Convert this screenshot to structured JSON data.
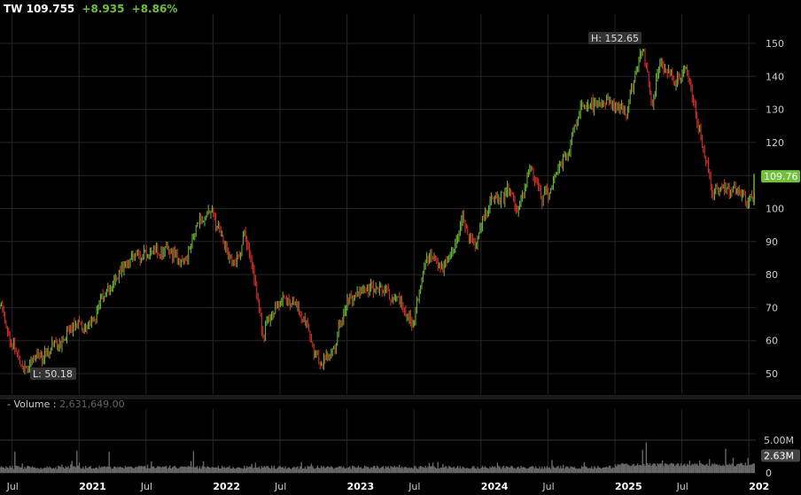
{
  "header": {
    "symbol": "TW",
    "price": "109.755",
    "change": "+8.935",
    "change_pct": "+8.86%"
  },
  "volume_panel": {
    "label": "- Volume :",
    "value": "2,631,649.00"
  },
  "colors": {
    "up": "#6fc13a",
    "down": "#e8322a",
    "grid": "#262626",
    "volume": "#6a6a6a",
    "last_price_bg": "#6fc13a"
  },
  "chart_data": {
    "type": "candlestick",
    "symbol": "TW",
    "x_axis": {
      "labels": [
        "Jul",
        "2021",
        "Jul",
        "2022",
        "Jul",
        "2023",
        "Jul",
        "2024",
        "Jul",
        "2025",
        "Jul",
        "202"
      ],
      "label_months_since_2020_06": [
        1,
        7,
        13,
        19,
        25,
        31,
        37,
        43,
        49,
        55,
        61,
        67
      ]
    },
    "y_axis": {
      "ticks": [
        50,
        60,
        70,
        80,
        90,
        100,
        110,
        120,
        130,
        140,
        150
      ],
      "range": [
        46,
        157
      ]
    },
    "price_path_months_since_2020_06": [
      [
        0,
        70
      ],
      [
        1.2,
        58
      ],
      [
        2.4,
        52
      ],
      [
        4,
        57
      ],
      [
        6.3,
        65
      ],
      [
        7.9,
        65
      ],
      [
        10.3,
        80
      ],
      [
        12.7,
        86
      ],
      [
        15.1,
        88
      ],
      [
        16.3,
        82
      ],
      [
        17.5,
        97
      ],
      [
        18.9,
        100
      ],
      [
        19.8,
        90
      ],
      [
        21,
        82
      ],
      [
        21.8,
        91
      ],
      [
        22.6,
        80
      ],
      [
        23.4,
        62
      ],
      [
        24.6,
        72
      ],
      [
        26.2,
        72
      ],
      [
        27.4,
        65
      ],
      [
        28.6,
        52
      ],
      [
        29.8,
        58
      ],
      [
        31,
        72
      ],
      [
        32.5,
        75
      ],
      [
        33.7,
        77
      ],
      [
        34.9,
        73
      ],
      [
        36.9,
        67
      ],
      [
        38.1,
        85
      ],
      [
        39.7,
        82
      ],
      [
        41.3,
        95
      ],
      [
        42.5,
        90
      ],
      [
        43.7,
        102
      ],
      [
        45.2,
        105
      ],
      [
        46.4,
        100
      ],
      [
        47.5,
        112
      ],
      [
        48.4,
        103
      ],
      [
        49.6,
        108
      ],
      [
        50.8,
        115
      ],
      [
        52,
        133
      ],
      [
        53.2,
        130
      ],
      [
        54.4,
        132
      ],
      [
        56,
        128
      ],
      [
        57.5,
        150
      ],
      [
        58.3,
        132
      ],
      [
        59.1,
        145
      ],
      [
        60.3,
        138
      ],
      [
        61.5,
        142
      ],
      [
        62.7,
        122
      ],
      [
        63.9,
        105
      ],
      [
        65.1,
        108
      ],
      [
        66.7,
        103
      ],
      [
        67.7,
        102
      ],
      [
        67.8,
        109.76
      ]
    ],
    "high_label": "H: 152.65",
    "low_label": "L: 50.18",
    "last_price_label": "109.76",
    "volume": {
      "ticks": [
        "0",
        "5.00M"
      ],
      "range": [
        0,
        5000000
      ],
      "last_label": "2.63M",
      "last": 2631649
    }
  }
}
